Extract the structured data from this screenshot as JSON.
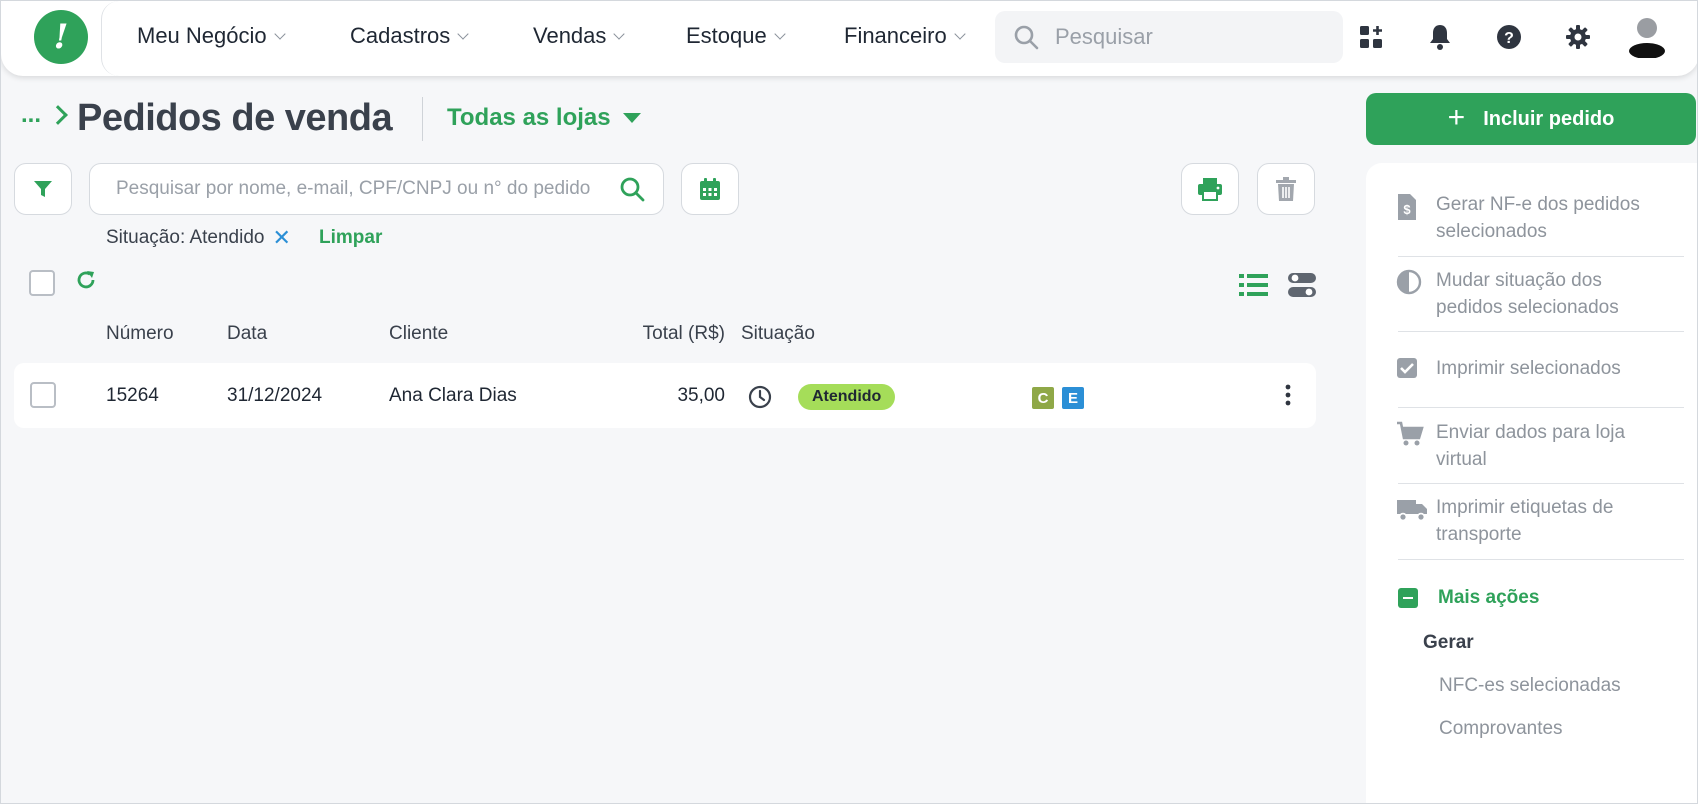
{
  "app": {
    "logo_glyph": "!",
    "brand_color": "#2fa25a"
  },
  "nav": {
    "items": [
      {
        "label": "Meu Negócio"
      },
      {
        "label": "Cadastros"
      },
      {
        "label": "Vendas"
      },
      {
        "label": "Estoque"
      },
      {
        "label": "Financeiro"
      }
    ],
    "search_placeholder": "Pesquisar",
    "icons": [
      "apps-icon",
      "bell-icon",
      "help-icon",
      "gear-icon",
      "avatar"
    ]
  },
  "header": {
    "breadcrumb": "...",
    "title": "Pedidos de venda",
    "store_selector": "Todas as lojas"
  },
  "toolbar": {
    "search_placeholder": "Pesquisar por nome, e-mail, CPF/CNPJ ou n° do pedido",
    "filter_label": "Situação: Atendido",
    "clear_label": "Limpar"
  },
  "table": {
    "columns": [
      "Número",
      "Data",
      "Cliente",
      "Total (R$)",
      "Situação"
    ],
    "rows": [
      {
        "numero": "15264",
        "data": "31/12/2024",
        "cliente": "Ana Clara Dias",
        "total": "35,00",
        "situacao": "Atendido",
        "tags": [
          "C",
          "E"
        ]
      }
    ],
    "status_color": "#a5dd59"
  },
  "side": {
    "include_label": "Incluir pedido",
    "actions": [
      "Gerar NF-e dos pedidos selecionados",
      "Mudar situação dos pedidos selecionados",
      "Imprimir selecionados",
      "Enviar dados para loja virtual",
      "Imprimir etiquetas de transporte"
    ],
    "more_label": "Mais ações",
    "group_title": "Gerar",
    "group_links": [
      "NFC-es selecionadas",
      "Comprovantes"
    ]
  }
}
